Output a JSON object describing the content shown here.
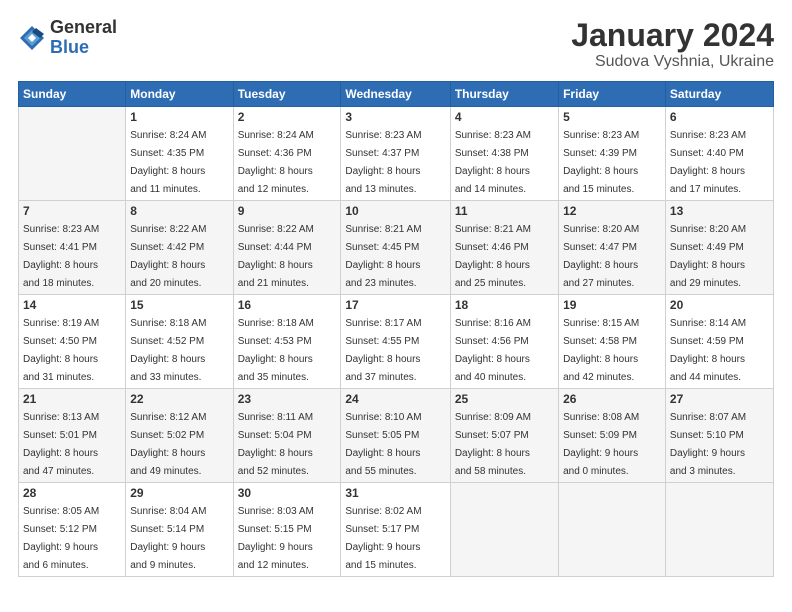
{
  "logo": {
    "general": "General",
    "blue": "Blue"
  },
  "title": "January 2024",
  "subtitle": "Sudova Vyshnia, Ukraine",
  "header_days": [
    "Sunday",
    "Monday",
    "Tuesday",
    "Wednesday",
    "Thursday",
    "Friday",
    "Saturday"
  ],
  "weeks": [
    [
      {
        "day": "",
        "info": ""
      },
      {
        "day": "1",
        "info": "Sunrise: 8:24 AM\nSunset: 4:35 PM\nDaylight: 8 hours\nand 11 minutes."
      },
      {
        "day": "2",
        "info": "Sunrise: 8:24 AM\nSunset: 4:36 PM\nDaylight: 8 hours\nand 12 minutes."
      },
      {
        "day": "3",
        "info": "Sunrise: 8:23 AM\nSunset: 4:37 PM\nDaylight: 8 hours\nand 13 minutes."
      },
      {
        "day": "4",
        "info": "Sunrise: 8:23 AM\nSunset: 4:38 PM\nDaylight: 8 hours\nand 14 minutes."
      },
      {
        "day": "5",
        "info": "Sunrise: 8:23 AM\nSunset: 4:39 PM\nDaylight: 8 hours\nand 15 minutes."
      },
      {
        "day": "6",
        "info": "Sunrise: 8:23 AM\nSunset: 4:40 PM\nDaylight: 8 hours\nand 17 minutes."
      }
    ],
    [
      {
        "day": "7",
        "info": "Sunrise: 8:23 AM\nSunset: 4:41 PM\nDaylight: 8 hours\nand 18 minutes."
      },
      {
        "day": "8",
        "info": "Sunrise: 8:22 AM\nSunset: 4:42 PM\nDaylight: 8 hours\nand 20 minutes."
      },
      {
        "day": "9",
        "info": "Sunrise: 8:22 AM\nSunset: 4:44 PM\nDaylight: 8 hours\nand 21 minutes."
      },
      {
        "day": "10",
        "info": "Sunrise: 8:21 AM\nSunset: 4:45 PM\nDaylight: 8 hours\nand 23 minutes."
      },
      {
        "day": "11",
        "info": "Sunrise: 8:21 AM\nSunset: 4:46 PM\nDaylight: 8 hours\nand 25 minutes."
      },
      {
        "day": "12",
        "info": "Sunrise: 8:20 AM\nSunset: 4:47 PM\nDaylight: 8 hours\nand 27 minutes."
      },
      {
        "day": "13",
        "info": "Sunrise: 8:20 AM\nSunset: 4:49 PM\nDaylight: 8 hours\nand 29 minutes."
      }
    ],
    [
      {
        "day": "14",
        "info": "Sunrise: 8:19 AM\nSunset: 4:50 PM\nDaylight: 8 hours\nand 31 minutes."
      },
      {
        "day": "15",
        "info": "Sunrise: 8:18 AM\nSunset: 4:52 PM\nDaylight: 8 hours\nand 33 minutes."
      },
      {
        "day": "16",
        "info": "Sunrise: 8:18 AM\nSunset: 4:53 PM\nDaylight: 8 hours\nand 35 minutes."
      },
      {
        "day": "17",
        "info": "Sunrise: 8:17 AM\nSunset: 4:55 PM\nDaylight: 8 hours\nand 37 minutes."
      },
      {
        "day": "18",
        "info": "Sunrise: 8:16 AM\nSunset: 4:56 PM\nDaylight: 8 hours\nand 40 minutes."
      },
      {
        "day": "19",
        "info": "Sunrise: 8:15 AM\nSunset: 4:58 PM\nDaylight: 8 hours\nand 42 minutes."
      },
      {
        "day": "20",
        "info": "Sunrise: 8:14 AM\nSunset: 4:59 PM\nDaylight: 8 hours\nand 44 minutes."
      }
    ],
    [
      {
        "day": "21",
        "info": "Sunrise: 8:13 AM\nSunset: 5:01 PM\nDaylight: 8 hours\nand 47 minutes."
      },
      {
        "day": "22",
        "info": "Sunrise: 8:12 AM\nSunset: 5:02 PM\nDaylight: 8 hours\nand 49 minutes."
      },
      {
        "day": "23",
        "info": "Sunrise: 8:11 AM\nSunset: 5:04 PM\nDaylight: 8 hours\nand 52 minutes."
      },
      {
        "day": "24",
        "info": "Sunrise: 8:10 AM\nSunset: 5:05 PM\nDaylight: 8 hours\nand 55 minutes."
      },
      {
        "day": "25",
        "info": "Sunrise: 8:09 AM\nSunset: 5:07 PM\nDaylight: 8 hours\nand 58 minutes."
      },
      {
        "day": "26",
        "info": "Sunrise: 8:08 AM\nSunset: 5:09 PM\nDaylight: 9 hours\nand 0 minutes."
      },
      {
        "day": "27",
        "info": "Sunrise: 8:07 AM\nSunset: 5:10 PM\nDaylight: 9 hours\nand 3 minutes."
      }
    ],
    [
      {
        "day": "28",
        "info": "Sunrise: 8:05 AM\nSunset: 5:12 PM\nDaylight: 9 hours\nand 6 minutes."
      },
      {
        "day": "29",
        "info": "Sunrise: 8:04 AM\nSunset: 5:14 PM\nDaylight: 9 hours\nand 9 minutes."
      },
      {
        "day": "30",
        "info": "Sunrise: 8:03 AM\nSunset: 5:15 PM\nDaylight: 9 hours\nand 12 minutes."
      },
      {
        "day": "31",
        "info": "Sunrise: 8:02 AM\nSunset: 5:17 PM\nDaylight: 9 hours\nand 15 minutes."
      },
      {
        "day": "",
        "info": ""
      },
      {
        "day": "",
        "info": ""
      },
      {
        "day": "",
        "info": ""
      }
    ]
  ]
}
